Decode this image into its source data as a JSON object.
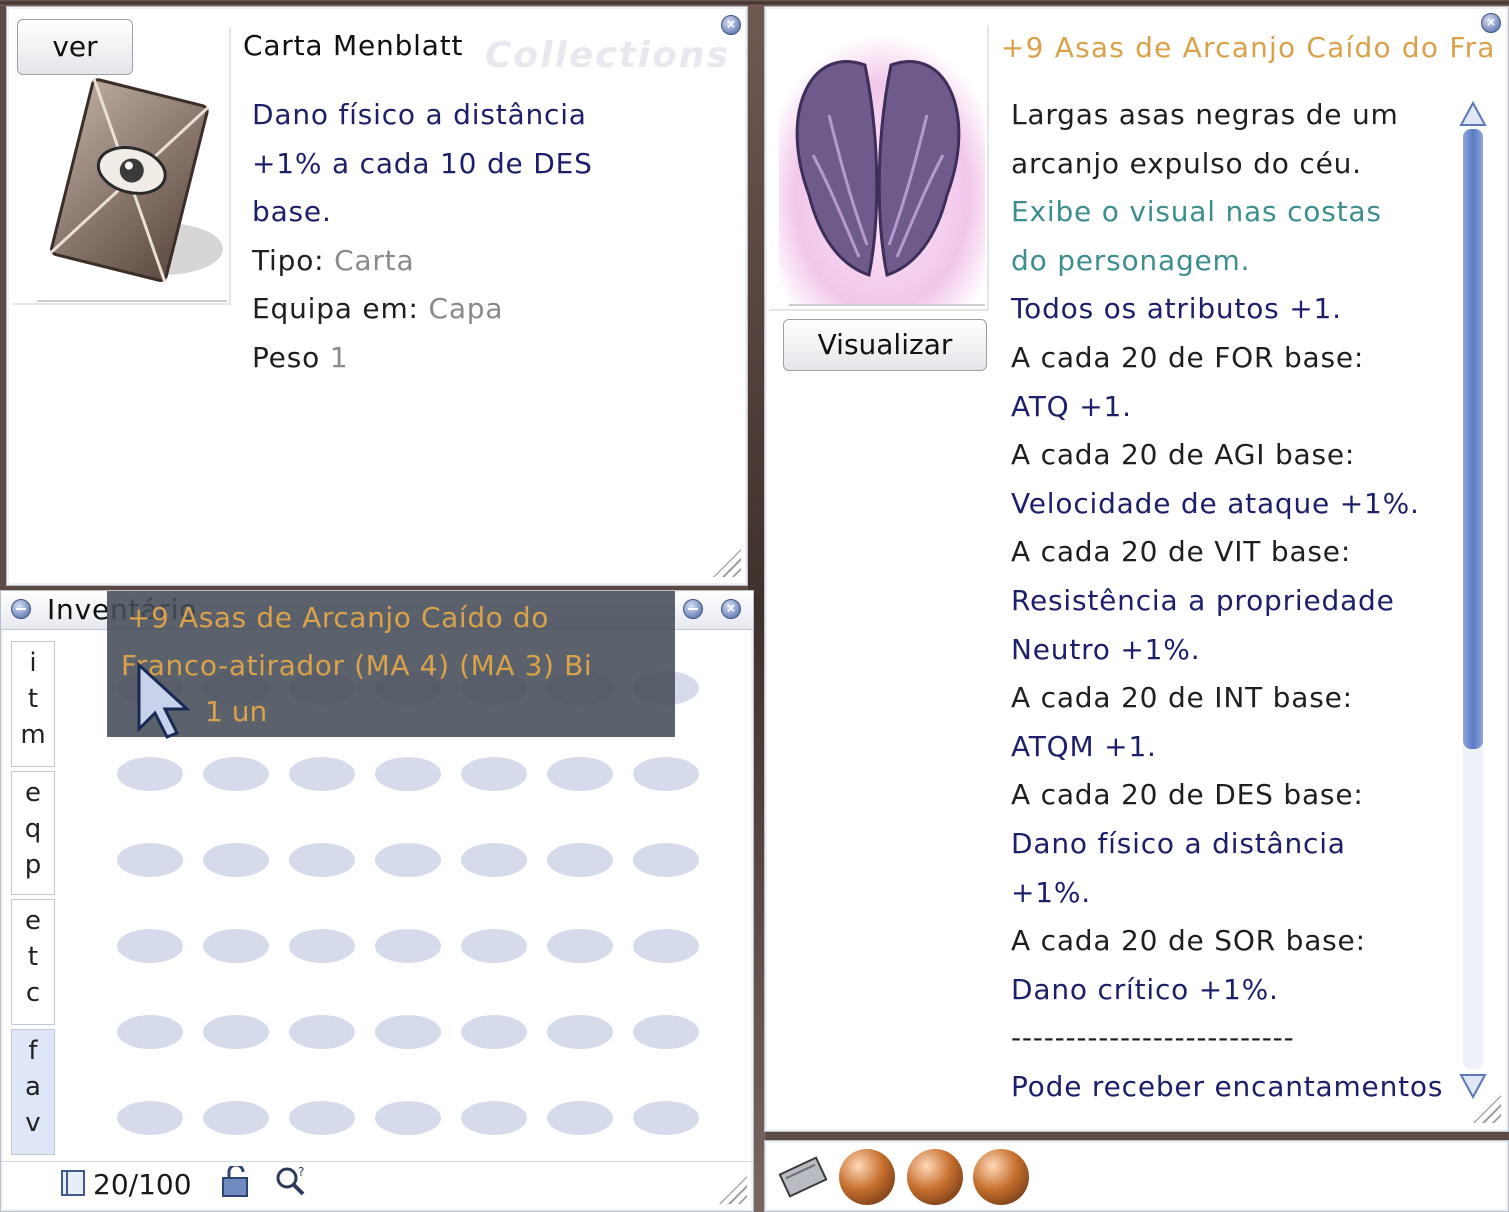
{
  "card_window": {
    "view_button": "ver",
    "title": "Carta Menblatt",
    "watermark": "Collections",
    "desc_lines": [
      {
        "text": "Dano físico a distância",
        "color": "navy"
      },
      {
        "text": "+1% a cada 10 de DES",
        "color": "navy"
      },
      {
        "text": "base.",
        "color": "navy"
      }
    ],
    "type_label": "Tipo:",
    "type_value": "Carta",
    "equip_label": "Equipa em:",
    "equip_value": "Capa",
    "weight_label": "Peso",
    "weight_value": "1"
  },
  "item_window": {
    "title": "+9 Asas de Arcanjo Caído do Fra",
    "visualize_button": "Visualizar",
    "desc_lines": [
      {
        "text": "Largas asas negras de um",
        "color": "dark"
      },
      {
        "text": "arcanjo expulso do céu.",
        "color": "dark"
      },
      {
        "text": "Exibe o visual nas costas",
        "color": "teal"
      },
      {
        "text": "do personagem.",
        "color": "teal"
      },
      {
        "text": "Todos os atributos +1.",
        "color": "navy"
      },
      {
        "text": "A cada 20 de FOR base:",
        "color": "dark"
      },
      {
        "text": "ATQ +1.",
        "color": "navy"
      },
      {
        "text": "A cada 20 de AGI base:",
        "color": "dark"
      },
      {
        "text": "Velocidade de ataque +1%.",
        "color": "navy"
      },
      {
        "text": "A cada 20 de VIT base:",
        "color": "dark"
      },
      {
        "text": "Resistência a propriedade",
        "color": "navy"
      },
      {
        "text": "Neutro +1%.",
        "color": "navy"
      },
      {
        "text": "A cada 20 de INT base:",
        "color": "dark"
      },
      {
        "text": "ATQM +1.",
        "color": "navy"
      },
      {
        "text": "A cada 20 de DES base:",
        "color": "dark"
      },
      {
        "text": "Dano físico a distância",
        "color": "navy"
      },
      {
        "text": "+1%.",
        "color": "navy"
      },
      {
        "text": "A cada 20 de SOR base:",
        "color": "dark"
      },
      {
        "text": "Dano crítico +1%.",
        "color": "navy"
      },
      {
        "text": "--------------------------",
        "color": "dark"
      },
      {
        "text": "Pode receber encantamentos",
        "color": "navy"
      }
    ]
  },
  "inventory_window": {
    "title": "Inventário",
    "tabs": [
      {
        "label": "itm"
      },
      {
        "label": "eqp"
      },
      {
        "label": "etc"
      },
      {
        "label": "fav"
      }
    ],
    "capacity": "20/100",
    "tooltip": {
      "line1": "+9 Asas de Arcanjo Caído do",
      "line2": "Franco-atirador (MA 4)  (MA 3)  Bi",
      "line3": "1 un"
    }
  },
  "colors": {
    "navy": "#1e1f6a",
    "teal": "#3e8e8e",
    "title_gold": "#d9a24a",
    "tooltip_bg": "#4f555f"
  },
  "icons": [
    "close-icon",
    "minimize-icon",
    "card-icon",
    "wings-icon",
    "book-icon",
    "lock-icon",
    "search-icon",
    "cursor-icon",
    "card-slot-icon",
    "orb-slot-icon"
  ]
}
